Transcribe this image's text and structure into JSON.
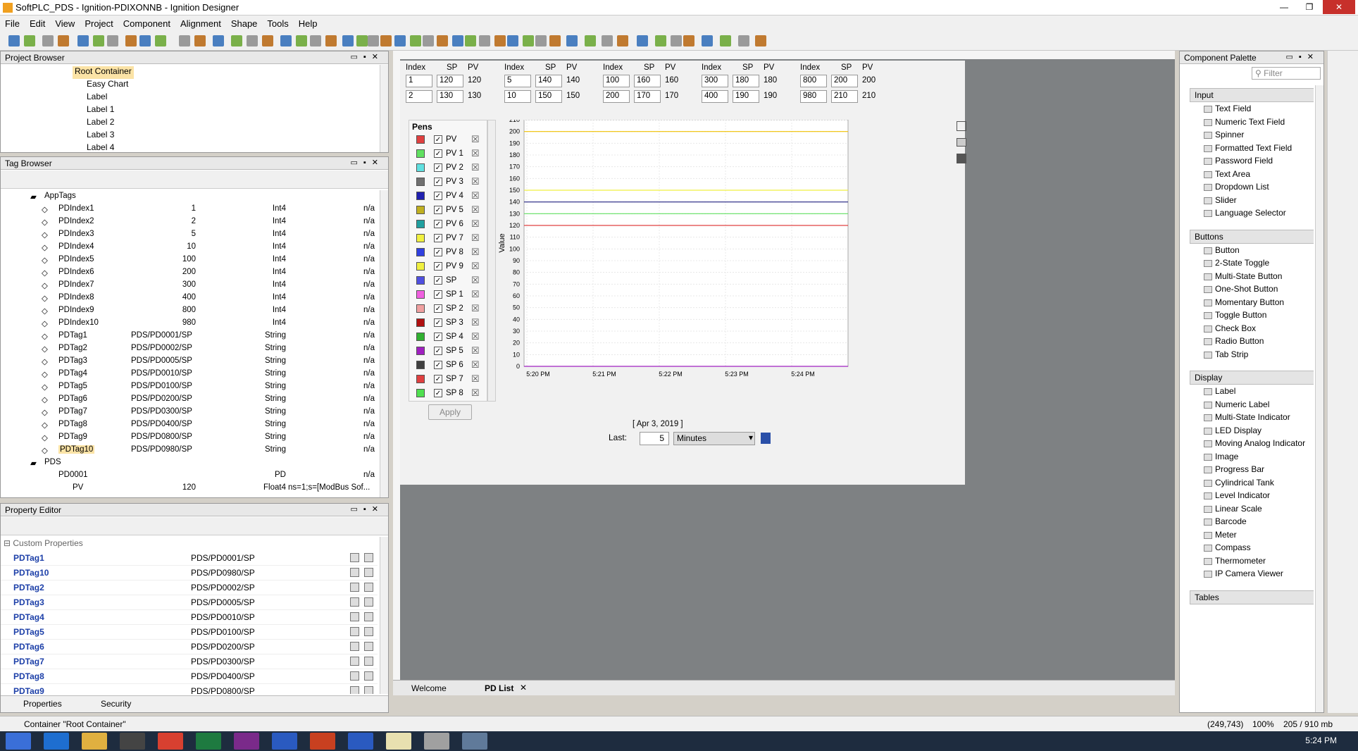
{
  "window": {
    "title": "SoftPLC_PDS - Ignition-PDIXONNB - Ignition Designer",
    "min": "—",
    "max": "❐",
    "close": "✕"
  },
  "menu": [
    "File",
    "Edit",
    "View",
    "Project",
    "Component",
    "Alignment",
    "Shape",
    "Tools",
    "Help"
  ],
  "project_browser": {
    "title": "Project Browser",
    "items": [
      "Root Container",
      "Easy Chart",
      "Label",
      "Label 1",
      "Label 2",
      "Label 3",
      "Label 4"
    ]
  },
  "tag_browser": {
    "title": "Tag Browser",
    "folder": "AppTags",
    "rows": [
      [
        "PDIndex1",
        "1",
        "Int4",
        "n/a"
      ],
      [
        "PDIndex2",
        "2",
        "Int4",
        "n/a"
      ],
      [
        "PDIndex3",
        "5",
        "Int4",
        "n/a"
      ],
      [
        "PDIndex4",
        "10",
        "Int4",
        "n/a"
      ],
      [
        "PDIndex5",
        "100",
        "Int4",
        "n/a"
      ],
      [
        "PDIndex6",
        "200",
        "Int4",
        "n/a"
      ],
      [
        "PDIndex7",
        "300",
        "Int4",
        "n/a"
      ],
      [
        "PDIndex8",
        "400",
        "Int4",
        "n/a"
      ],
      [
        "PDIndex9",
        "800",
        "Int4",
        "n/a"
      ],
      [
        "PDIndex10",
        "980",
        "Int4",
        "n/a"
      ],
      [
        "PDTag1",
        "PDS/PD0001/SP",
        "String",
        "n/a"
      ],
      [
        "PDTag2",
        "PDS/PD0002/SP",
        "String",
        "n/a"
      ],
      [
        "PDTag3",
        "PDS/PD0005/SP",
        "String",
        "n/a"
      ],
      [
        "PDTag4",
        "PDS/PD0010/SP",
        "String",
        "n/a"
      ],
      [
        "PDTag5",
        "PDS/PD0100/SP",
        "String",
        "n/a"
      ],
      [
        "PDTag6",
        "PDS/PD0200/SP",
        "String",
        "n/a"
      ],
      [
        "PDTag7",
        "PDS/PD0300/SP",
        "String",
        "n/a"
      ],
      [
        "PDTag8",
        "PDS/PD0400/SP",
        "String",
        "n/a"
      ],
      [
        "PDTag9",
        "PDS/PD0800/SP",
        "String",
        "n/a"
      ],
      [
        "PDTag10",
        "PDS/PD0980/SP",
        "String",
        "n/a"
      ]
    ],
    "pds_folder": "PDS",
    "pd0001": [
      "PD0001",
      "",
      "PD",
      "n/a"
    ],
    "pv_row": [
      "PV",
      "120",
      "Float4",
      "ns=1;s=[ModBus Sof..."
    ]
  },
  "property_editor": {
    "title": "Property Editor",
    "group": "Custom Properties",
    "rows": [
      [
        "PDTag1",
        "PDS/PD0001/SP"
      ],
      [
        "PDTag10",
        "PDS/PD0980/SP"
      ],
      [
        "PDTag2",
        "PDS/PD0002/SP"
      ],
      [
        "PDTag3",
        "PDS/PD0005/SP"
      ],
      [
        "PDTag4",
        "PDS/PD0010/SP"
      ],
      [
        "PDTag5",
        "PDS/PD0100/SP"
      ],
      [
        "PDTag6",
        "PDS/PD0200/SP"
      ],
      [
        "PDTag7",
        "PDS/PD0300/SP"
      ],
      [
        "PDTag8",
        "PDS/PD0400/SP"
      ],
      [
        "PDTag9",
        "PDS/PD0800/SP"
      ]
    ],
    "tabs": [
      "Properties",
      "Security"
    ]
  },
  "pd_table": {
    "headers": [
      "Index",
      "SP",
      "PV"
    ],
    "groups": [
      [
        [
          "1",
          "120",
          "120"
        ],
        [
          "2",
          "130",
          "130"
        ]
      ],
      [
        [
          "5",
          "140",
          "140"
        ],
        [
          "10",
          "150",
          "150"
        ]
      ],
      [
        [
          "100",
          "160",
          "160"
        ],
        [
          "200",
          "170",
          "170"
        ]
      ],
      [
        [
          "300",
          "180",
          "180"
        ],
        [
          "400",
          "190",
          "190"
        ]
      ],
      [
        [
          "800",
          "200",
          "200"
        ],
        [
          "980",
          "210",
          "210"
        ]
      ]
    ]
  },
  "pens": {
    "title": "Pens",
    "items": [
      {
        "name": "PV",
        "color": "#e04040"
      },
      {
        "name": "PV 1",
        "color": "#60e060"
      },
      {
        "name": "PV 2",
        "color": "#60e0e0"
      },
      {
        "name": "PV 3",
        "color": "#707070"
      },
      {
        "name": "PV 4",
        "color": "#2020b0"
      },
      {
        "name": "PV 5",
        "color": "#c0b020"
      },
      {
        "name": "PV 6",
        "color": "#20a0a0"
      },
      {
        "name": "PV 7",
        "color": "#f0f040"
      },
      {
        "name": "PV 8",
        "color": "#3040e0"
      },
      {
        "name": "PV 9",
        "color": "#f0f040"
      },
      {
        "name": "SP",
        "color": "#5050e0"
      },
      {
        "name": "SP 1",
        "color": "#f060e0"
      },
      {
        "name": "SP 2",
        "color": "#f0a0a0"
      },
      {
        "name": "SP 3",
        "color": "#b01010"
      },
      {
        "name": "SP 4",
        "color": "#30b030"
      },
      {
        "name": "SP 5",
        "color": "#a020c0"
      },
      {
        "name": "SP 6",
        "color": "#404040"
      },
      {
        "name": "SP 7",
        "color": "#e04040"
      },
      {
        "name": "SP 8",
        "color": "#50e050"
      }
    ],
    "apply": "Apply"
  },
  "chart_data": {
    "type": "line",
    "ylabel": "Value",
    "xlabel": "[ Apr 3, 2019 ]",
    "ylim": [
      0,
      210
    ],
    "yticks": [
      0,
      10,
      20,
      30,
      40,
      50,
      60,
      70,
      80,
      90,
      100,
      110,
      120,
      130,
      140,
      150,
      160,
      170,
      180,
      190,
      200,
      210
    ],
    "x": [
      "5:20 PM",
      "5:21 PM",
      "5:22 PM",
      "5:23 PM",
      "5:24 PM"
    ],
    "series": [
      {
        "value": 200,
        "color": "#f0c000"
      },
      {
        "value": 150,
        "color": "#f0f040"
      },
      {
        "value": 140,
        "color": "#202080"
      },
      {
        "value": 130,
        "color": "#60e060"
      },
      {
        "value": 120,
        "color": "#e04040"
      },
      {
        "value": 0,
        "color": "#a020c0"
      }
    ]
  },
  "chart_footer": {
    "last_label": "Last:",
    "last_value": "5",
    "unit": "Minutes"
  },
  "canvas_tabs": [
    "Welcome",
    "PD List"
  ],
  "palette": {
    "title": "Component Palette",
    "filter": "Filter",
    "sections": [
      {
        "name": "Input",
        "items": [
          "Text Field",
          "Numeric Text Field",
          "Spinner",
          "Formatted Text Field",
          "Password Field",
          "Text Area",
          "Dropdown List",
          "Slider",
          "Language Selector"
        ]
      },
      {
        "name": "Buttons",
        "items": [
          "Button",
          "2-State Toggle",
          "Multi-State Button",
          "One-Shot Button",
          "Momentary Button",
          "Toggle Button",
          "Check Box",
          "Radio Button",
          "Tab Strip"
        ]
      },
      {
        "name": "Display",
        "items": [
          "Label",
          "Numeric Label",
          "Multi-State Indicator",
          "LED Display",
          "Moving Analog Indicator",
          "Image",
          "Progress Bar",
          "Cylindrical Tank",
          "Level Indicator",
          "Linear Scale",
          "Barcode",
          "Meter",
          "Compass",
          "Thermometer",
          "IP Camera Viewer"
        ]
      },
      {
        "name": "Tables",
        "items": []
      }
    ]
  },
  "status": {
    "left": "Container \"Root Container\"",
    "coords": "(249,743)",
    "zoom": "100%",
    "memory": "205 / 910 mb"
  },
  "taskbar": {
    "time": "5:24 PM"
  }
}
